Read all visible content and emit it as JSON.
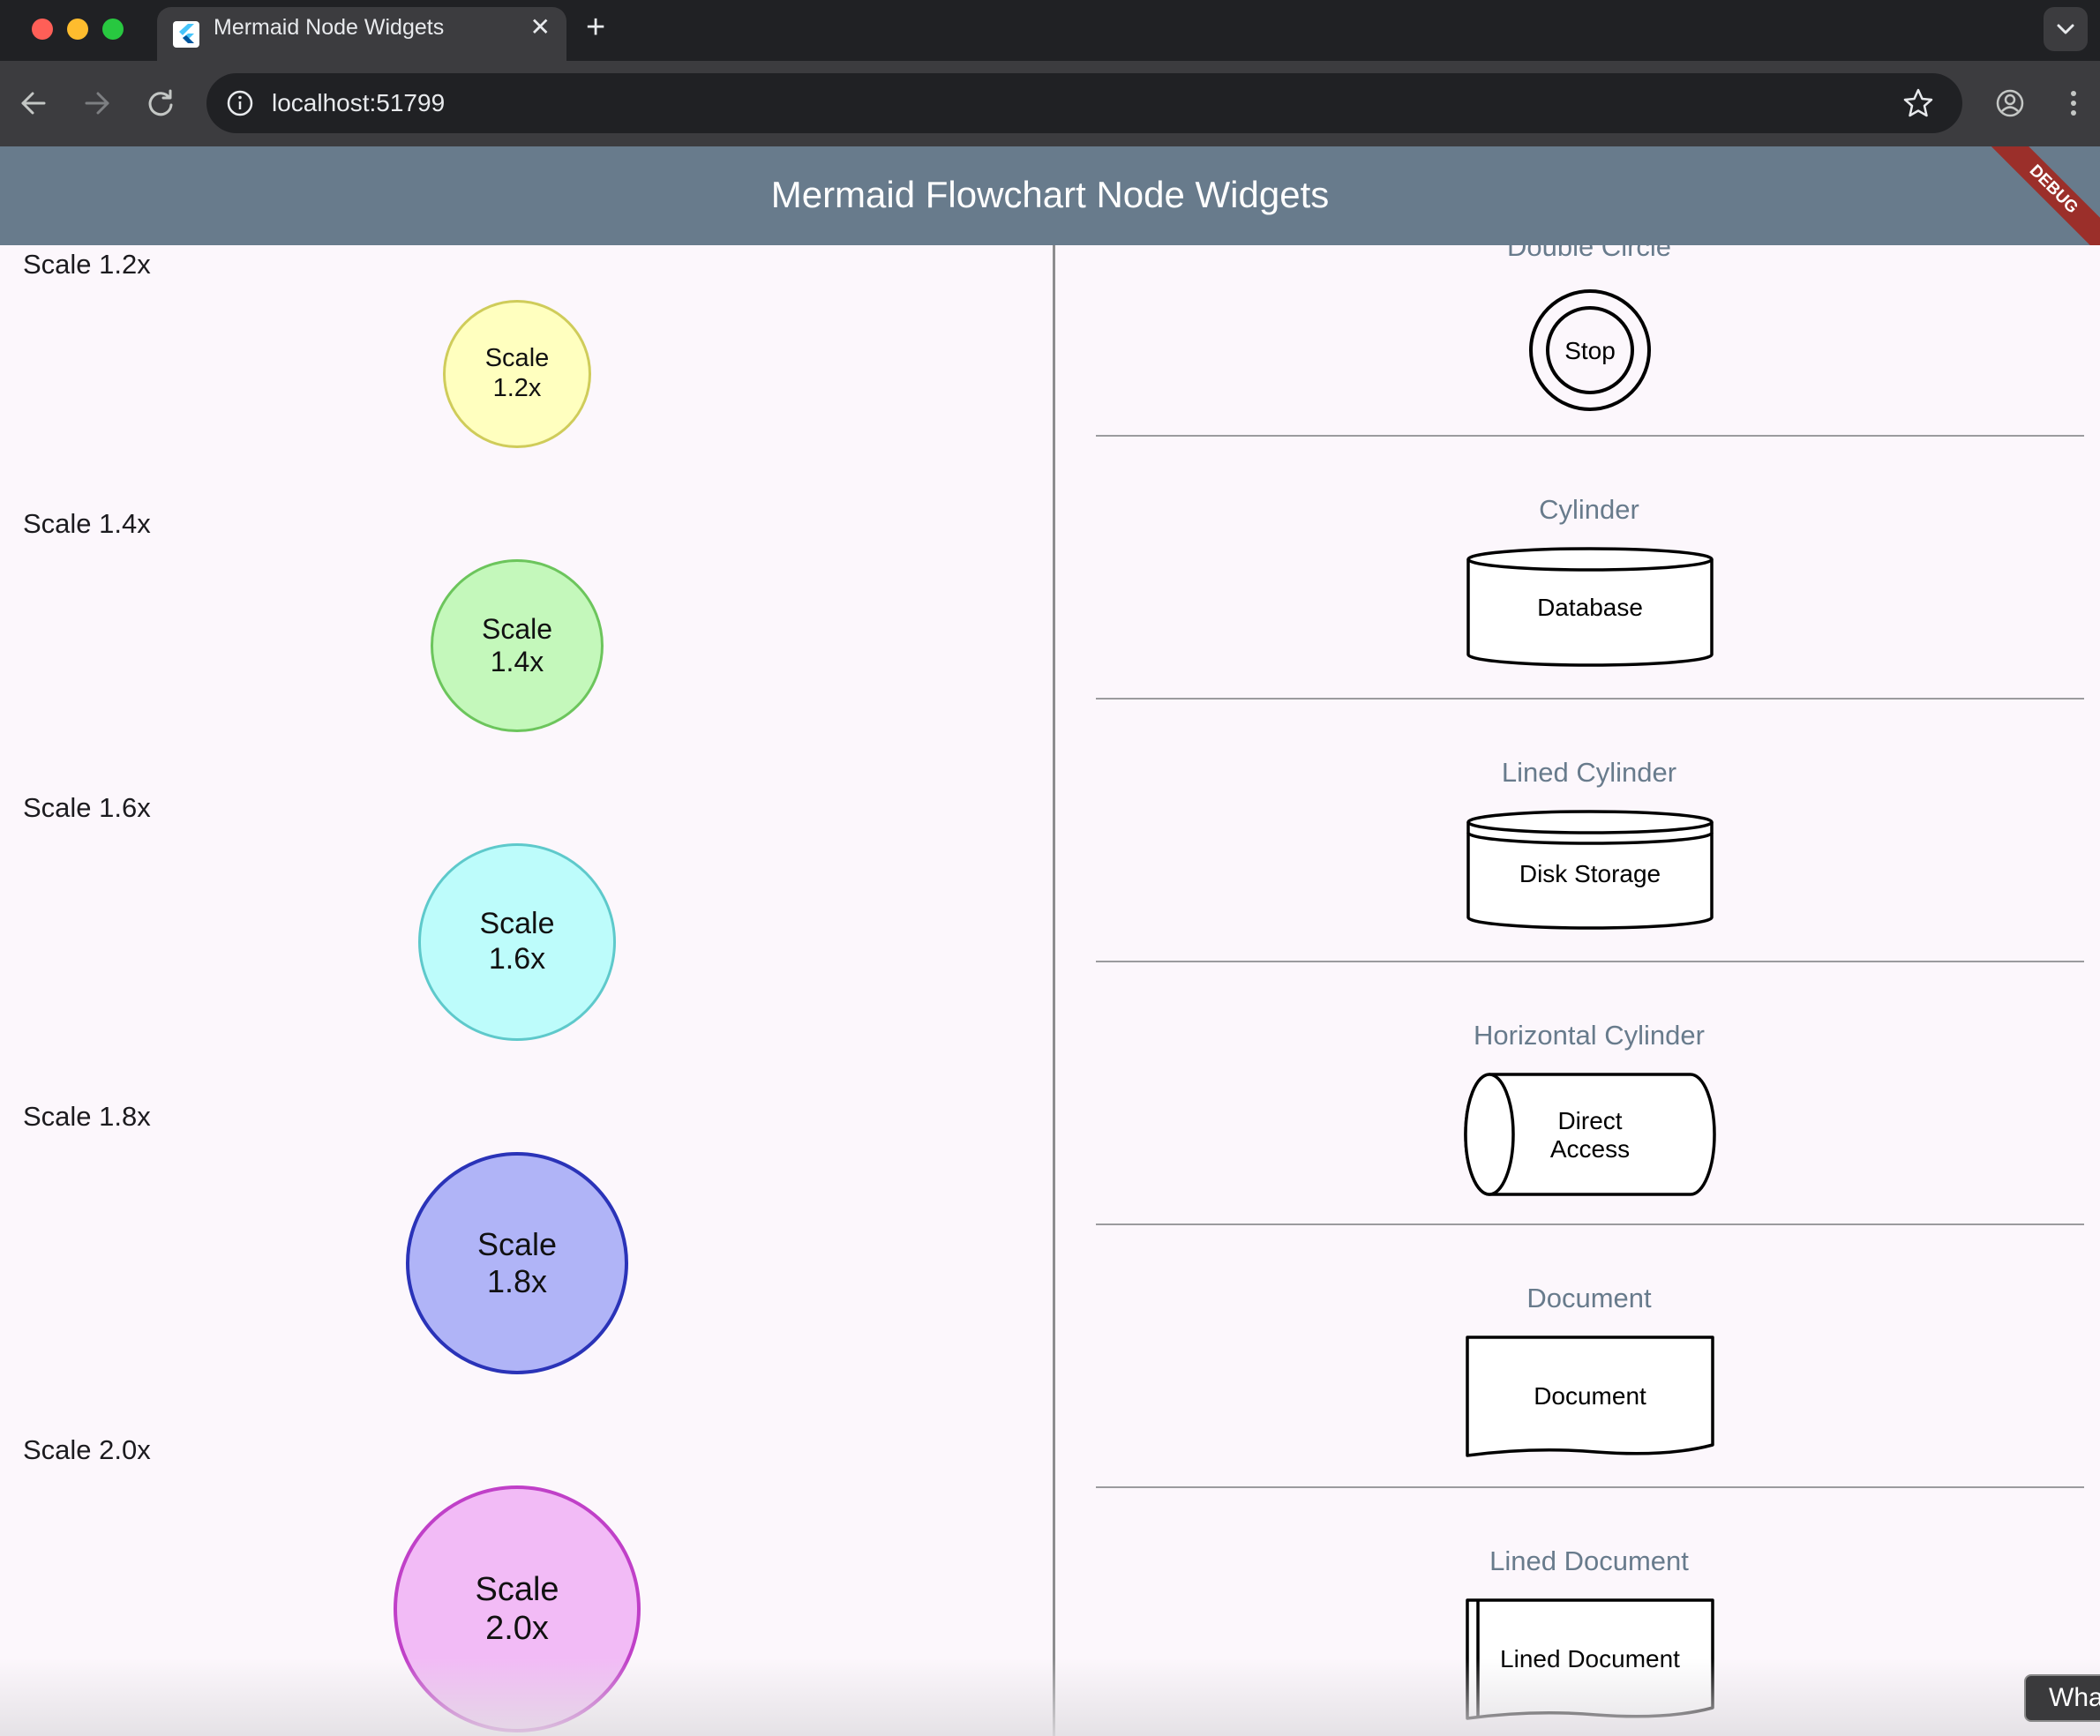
{
  "browser": {
    "tab_title": "Mermaid Node Widgets",
    "tab_close": "✕",
    "new_tab": "+",
    "url": "localhost:51799"
  },
  "app": {
    "title": "Mermaid Flowchart Node Widgets",
    "debug_banner": "DEBUG"
  },
  "scales": [
    {
      "label": "Scale 1.2x",
      "node_line1": "Scale",
      "node_line2": "1.2x",
      "fill": "#ffffbf",
      "border": "#cfcc5a"
    },
    {
      "label": "Scale 1.4x",
      "node_line1": "Scale",
      "node_line2": "1.4x",
      "fill": "#c4f8bb",
      "border": "#6cc55c"
    },
    {
      "label": "Scale 1.6x",
      "node_line1": "Scale",
      "node_line2": "1.6x",
      "fill": "#bdfcfb",
      "border": "#5ec9cb"
    },
    {
      "label": "Scale 1.8x",
      "node_line1": "Scale",
      "node_line2": "1.8x",
      "fill": "#b0b4f7",
      "border": "#2a33b8"
    },
    {
      "label": "Scale 2.0x",
      "node_line1": "Scale",
      "node_line2": "2.0x",
      "fill": "#f2bbf6",
      "border": "#c040c8"
    }
  ],
  "shapes": [
    {
      "title": "Double Circle",
      "node_text": "Stop"
    },
    {
      "title": "Cylinder",
      "node_text": "Database"
    },
    {
      "title": "Lined Cylinder",
      "node_text": "Disk Storage"
    },
    {
      "title": "Horizontal Cylinder",
      "node_line1": "Direct",
      "node_line2": "Access"
    },
    {
      "title": "Document",
      "node_text": "Document"
    },
    {
      "title": "Lined Document",
      "node_text": "Lined Document"
    }
  ],
  "snackbar": {
    "text": "Wha"
  }
}
